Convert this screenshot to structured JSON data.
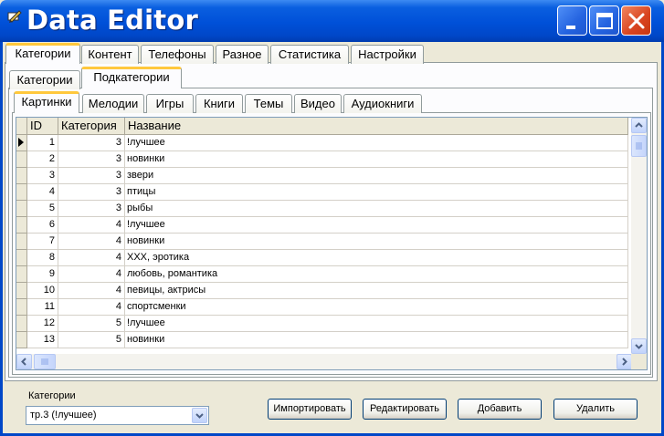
{
  "window": {
    "title": "Data Editor",
    "icon": "pencil-icon"
  },
  "tabs_level1": [
    "Категории",
    "Контент",
    "Телефоны",
    "Разное",
    "Статистика",
    "Настройки"
  ],
  "tabs_level2": [
    "Категории",
    "Подкатегории"
  ],
  "tabs_level3": [
    "Картинки",
    "Мелодии",
    "Игры",
    "Книги",
    "Темы",
    "Видео",
    "Аудиокниги"
  ],
  "grid": {
    "columns": [
      "ID",
      "Категория",
      "Название"
    ],
    "rows": [
      {
        "id": "1",
        "cat": "3",
        "name": "!лучшее"
      },
      {
        "id": "2",
        "cat": "3",
        "name": "новинки"
      },
      {
        "id": "3",
        "cat": "3",
        "name": "звери"
      },
      {
        "id": "4",
        "cat": "3",
        "name": "птицы"
      },
      {
        "id": "5",
        "cat": "3",
        "name": "рыбы"
      },
      {
        "id": "6",
        "cat": "4",
        "name": "!лучшее"
      },
      {
        "id": "7",
        "cat": "4",
        "name": "новинки"
      },
      {
        "id": "8",
        "cat": "4",
        "name": "XXX, эротика"
      },
      {
        "id": "9",
        "cat": "4",
        "name": "любовь, романтика"
      },
      {
        "id": "10",
        "cat": "4",
        "name": "певицы, актрисы"
      },
      {
        "id": "11",
        "cat": "4",
        "name": "спортсменки"
      },
      {
        "id": "12",
        "cat": "5",
        "name": "!лучшее"
      },
      {
        "id": "13",
        "cat": "5",
        "name": "новинки"
      }
    ]
  },
  "bottom": {
    "category_label": "Категории",
    "category_value": "тр.3 (!лучшее)",
    "import_label": "Импортировать",
    "edit_label": "Редактировать",
    "add_label": "Добавить",
    "delete_label": "Удалить"
  },
  "colors": {
    "titlebar": "#0050d8",
    "active_tab_accent": "#ffc83c",
    "close_button": "#d8431f"
  }
}
